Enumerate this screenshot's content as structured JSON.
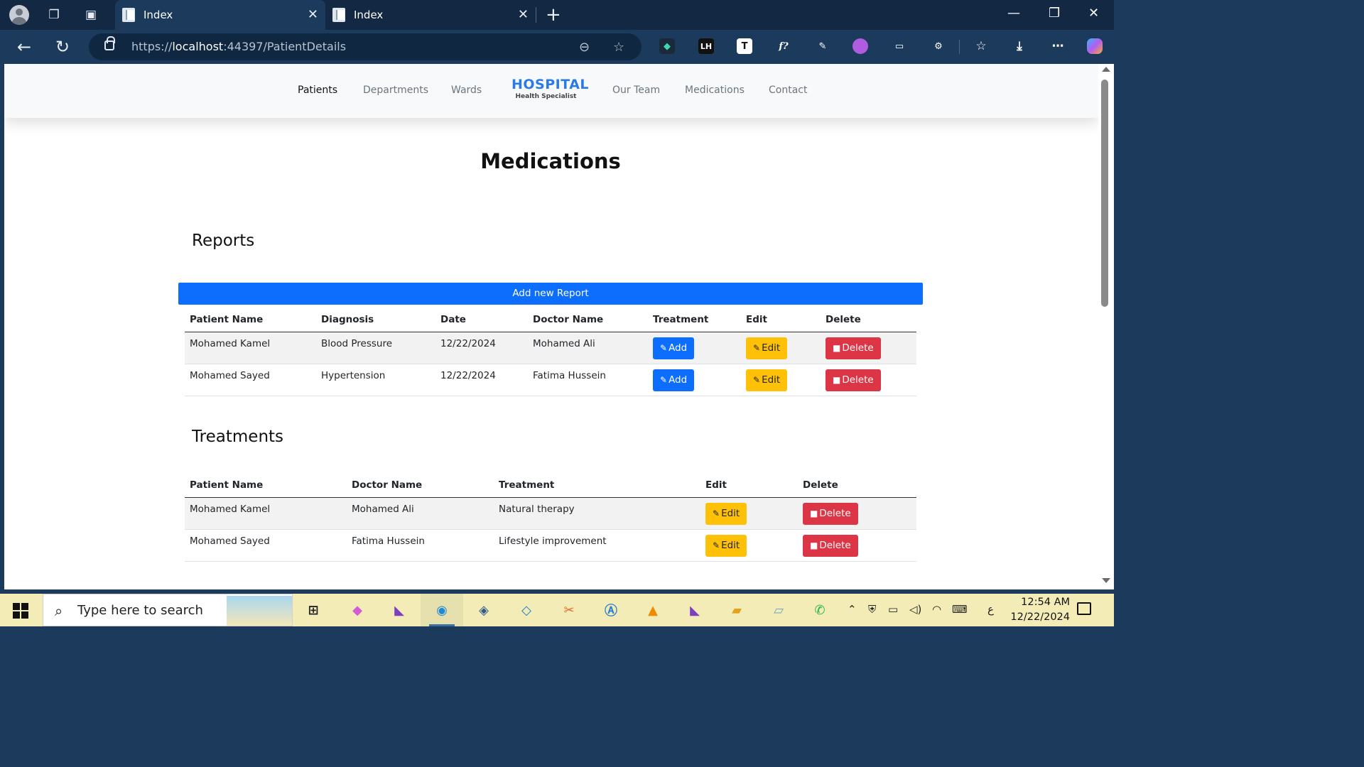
{
  "browser": {
    "tabs": [
      {
        "title": "Index",
        "active": true
      },
      {
        "title": "Index",
        "active": false
      }
    ],
    "url_prefix": "https://",
    "url_host": "localhost",
    "url_rest": ":44397/PatientDetails",
    "extensions": [
      "copilot-ext",
      "lh-ext",
      "t-ext",
      "f-ext",
      "dropper-ext",
      "paint-ext",
      "cast-ext",
      "puzzle-ext"
    ]
  },
  "site": {
    "nav_left": [
      "Patients",
      "Departments",
      "Wards"
    ],
    "brand_title": "HOSPITAL",
    "brand_subtitle": "Health Specialist",
    "nav_right": [
      "Our Team",
      "Medications",
      "Contact"
    ]
  },
  "page": {
    "title": "Medications"
  },
  "reports": {
    "section_title": "Reports",
    "add_label": "Add new Report",
    "columns": [
      "Patient Name",
      "Diagnosis",
      "Date",
      "Doctor Name",
      "Treatment",
      "Edit",
      "Delete"
    ],
    "rows": [
      {
        "patient": "Mohamed Kamel",
        "diagnosis": "Blood Pressure",
        "date": "12/22/2024",
        "doctor": "Mohamed Ali"
      },
      {
        "patient": "Mohamed Sayed",
        "diagnosis": "Hypertension",
        "date": "12/22/2024",
        "doctor": "Fatima Hussein"
      }
    ],
    "btn_add": "Add",
    "btn_edit": "Edit",
    "btn_delete": "Delete"
  },
  "treatments": {
    "section_title": "Treatments",
    "columns": [
      "Patient Name",
      "Doctor Name",
      "Treatment",
      "Edit",
      "Delete"
    ],
    "rows": [
      {
        "patient": "Mohamed Kamel",
        "doctor": "Mohamed Ali",
        "treatment": "Natural therapy"
      },
      {
        "patient": "Mohamed Sayed",
        "doctor": "Fatima Hussein",
        "treatment": "Lifestyle improvement"
      }
    ],
    "btn_edit": "Edit",
    "btn_delete": "Delete"
  },
  "taskbar": {
    "search_placeholder": "Type here to search",
    "time": "12:54 AM",
    "date": "12/22/2024",
    "lang": "ع"
  },
  "colors": {
    "primary": "#0d6efd",
    "warning": "#ffc107",
    "danger": "#dc3545",
    "brand": "#2c7be5"
  }
}
